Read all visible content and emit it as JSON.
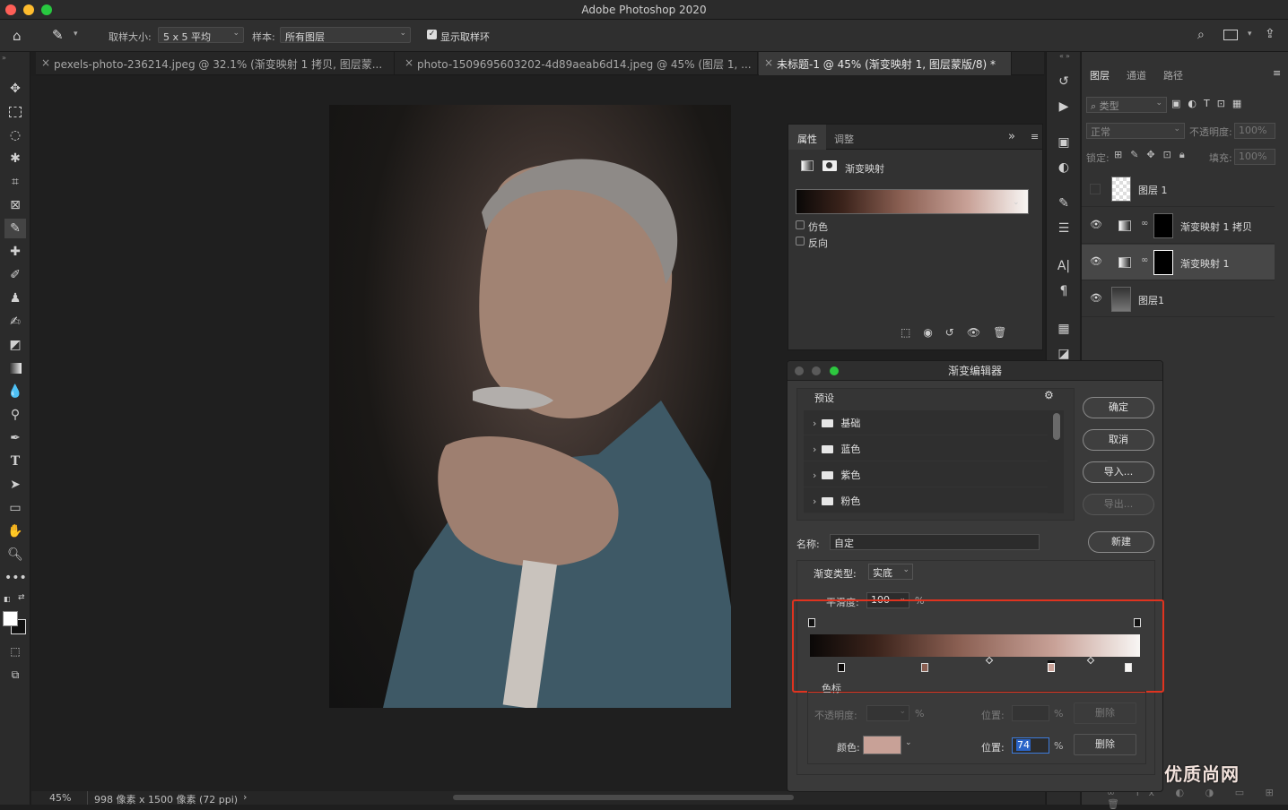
{
  "app": {
    "title": "Adobe Photoshop 2020"
  },
  "options_bar": {
    "sample_size_label": "取样大小:",
    "sample_size_value": "5 x 5 平均",
    "sample_label": "样本:",
    "sample_value": "所有图层",
    "show_ring_label": "显示取样环",
    "show_ring_checked": true
  },
  "tabs": [
    {
      "label": "pexels-photo-236214.jpeg @ 32.1% (渐变映射 1 拷贝, 图层蒙..."
    },
    {
      "label": "photo-1509695603202-4d89aeab6d14.jpeg @ 45% (图层 1, ..."
    },
    {
      "label": "未标题-1 @ 45% (渐变映射 1, 图层蒙版/8) *",
      "active": true
    }
  ],
  "status": {
    "zoom": "45%",
    "doc_info": "998 像素 x 1500 像素 (72 ppi)",
    "arrow": "›"
  },
  "properties_panel": {
    "tab_properties": "属性",
    "tab_adjust": "调整",
    "expand": "»",
    "adj_name": "渐变映射",
    "dither_label": "仿色",
    "reverse_label": "反向"
  },
  "layers_panel": {
    "tabs": [
      "图层",
      "通道",
      "路径"
    ],
    "filter_label": "类型",
    "blend_mode": "正常",
    "opacity_label": "不透明度:",
    "opacity_value": "100%",
    "lock_label": "锁定:",
    "fill_label": "填充:",
    "fill_value": "100%",
    "layers": [
      {
        "name": "图层 1",
        "visible": false
      },
      {
        "name": "渐变映射 1 拷贝",
        "visible": true
      },
      {
        "name": "渐变映射 1",
        "visible": true,
        "selected": true
      },
      {
        "name": "图层1",
        "visible": true
      }
    ]
  },
  "gradient_editor": {
    "title": "渐变编辑器",
    "presets_label": "预设",
    "presets": [
      "基础",
      "蓝色",
      "紫色",
      "粉色"
    ],
    "buttons": {
      "ok": "确定",
      "cancel": "取消",
      "import": "导入...",
      "export": "导出...",
      "new": "新建"
    },
    "name_label": "名称:",
    "name_value": "自定",
    "type_label": "渐变类型:",
    "type_value": "实底",
    "smooth_label": "平滑度:",
    "smooth_value": "100",
    "percent": "%",
    "stops_section": "色标",
    "opacity_label": "不透明度:",
    "position_label": "位置:",
    "delete_label": "删除",
    "color_label": "颜色:",
    "color_position": "74",
    "selected_color": "#c8a197"
  },
  "colors": {
    "highlight_red": "#e0331f",
    "gradient_start": "#0a0807",
    "gradient_mid": "#8a5f52",
    "gradient_end": "#f8f6f4"
  },
  "watermark": "优质尚网"
}
